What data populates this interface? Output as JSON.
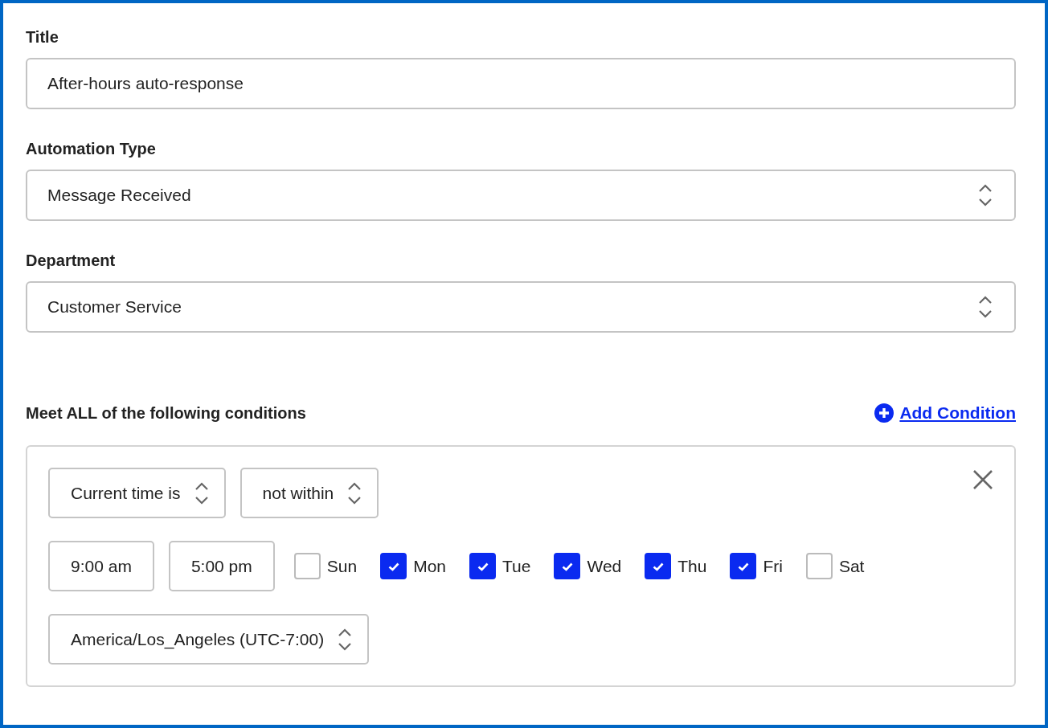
{
  "fields": [
    {
      "kind": "text",
      "label": "Title",
      "value": "After-hours auto-response"
    },
    {
      "kind": "select",
      "label": "Automation Type",
      "value": "Message Received"
    },
    {
      "kind": "select",
      "label": "Department",
      "value": "Customer Service"
    }
  ],
  "conditions": {
    "heading": "Meet ALL of the following conditions",
    "add_link": "Add Condition",
    "subject": "Current time is",
    "operator": "not within",
    "start_time": "9:00 am",
    "end_time": "5:00 pm",
    "days": [
      {
        "label": "Sun",
        "checked": false
      },
      {
        "label": "Mon",
        "checked": true
      },
      {
        "label": "Tue",
        "checked": true
      },
      {
        "label": "Wed",
        "checked": true
      },
      {
        "label": "Thu",
        "checked": true
      },
      {
        "label": "Fri",
        "checked": true
      },
      {
        "label": "Sat",
        "checked": false
      }
    ],
    "timezone": "America/Los_Angeles (UTC-7:00)"
  }
}
